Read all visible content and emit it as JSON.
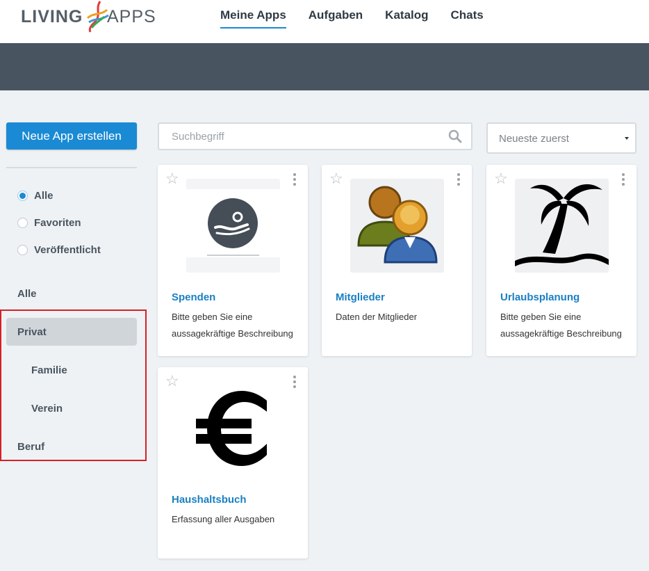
{
  "header": {
    "logo_left": "LIVING",
    "logo_right": "APPS",
    "nav": [
      {
        "label": "Meine Apps",
        "active": true
      },
      {
        "label": "Aufgaben",
        "active": false
      },
      {
        "label": "Katalog",
        "active": false
      },
      {
        "label": "Chats",
        "active": false
      }
    ]
  },
  "sidebar": {
    "new_app_label": "Neue App erstellen",
    "filters": [
      {
        "label": "Alle",
        "checked": true
      },
      {
        "label": "Favoriten",
        "checked": false
      },
      {
        "label": "Veröffentlicht",
        "checked": false
      }
    ],
    "categories": {
      "all": "Alle",
      "private": "Privat",
      "family": "Familie",
      "club": "Verein",
      "work": "Beruf"
    }
  },
  "search": {
    "placeholder": "Suchbegriff",
    "icon": "search-icon"
  },
  "sort": {
    "selected": "Neueste zuerst"
  },
  "apps": [
    {
      "title": "Spenden",
      "description": "Bitte geben Sie eine aussagekräftige Beschreibung",
      "icon": "donation-hand-icon"
    },
    {
      "title": "Mitglieder",
      "description": "Daten der Mitglieder",
      "icon": "users-icon"
    },
    {
      "title": "Urlaubsplanung",
      "description": "Bitte geben Sie eine aussagekräftige Beschreibung",
      "icon": "palm-tree-icon"
    },
    {
      "title": "Haushaltsbuch",
      "description": "Erfassung aller Ausgaben",
      "icon": "euro-icon"
    }
  ],
  "colors": {
    "accent": "#1a8ad4",
    "banner": "#485560",
    "highlight_border": "#d61f26"
  }
}
